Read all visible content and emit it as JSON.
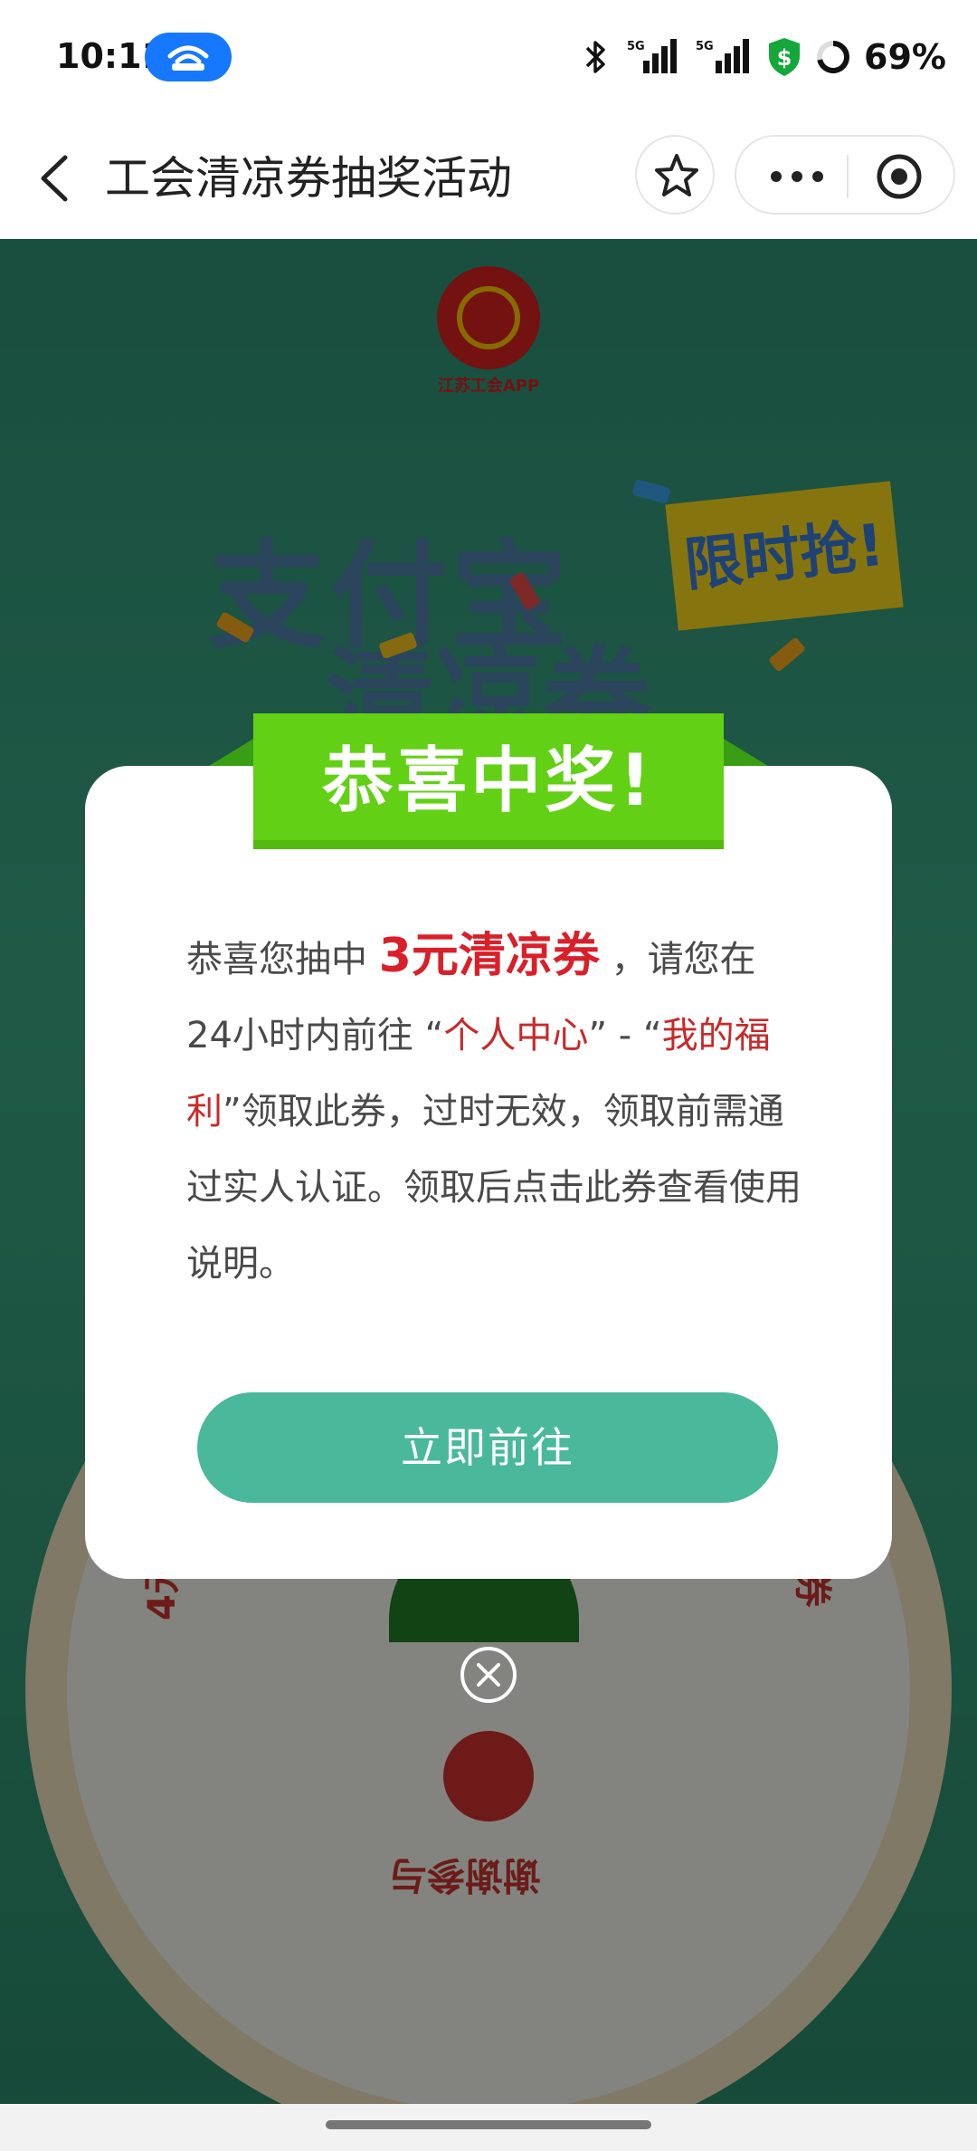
{
  "status_bar": {
    "time": "10:11",
    "battery": "69%",
    "network_labels": [
      "5G",
      "5G"
    ]
  },
  "nav": {
    "title": "工会清凉券抽奖活动",
    "icons": [
      "back-icon",
      "star-icon",
      "more-icon",
      "target-icon"
    ]
  },
  "background": {
    "logo_caption": "江苏工会APP",
    "banner_line1": "支付宝",
    "banner_line2": "清凉券",
    "limited_badge": "限时抢!",
    "wheel_labels": [
      "4元",
      "券",
      "谢谢参与"
    ]
  },
  "modal": {
    "ribbon_title": "恭喜中奖!",
    "text_prefix": "恭喜您抽中 ",
    "prize": "3元清凉券",
    "text_mid1": " ，请您在24小时内前往 “",
    "link1": "个人中心",
    "text_mid2": "” - “",
    "link2": "我的福利",
    "text_suffix": "”领取此券，过时无效，领取前需通过实人认证。领取后点击此券查看使用说明。",
    "button_label": "立即前往"
  },
  "colors": {
    "accent_button": "#4ab89b",
    "prize_red": "#d9202a",
    "ribbon_green": "#62d014",
    "status_pill": "#1677ff"
  }
}
